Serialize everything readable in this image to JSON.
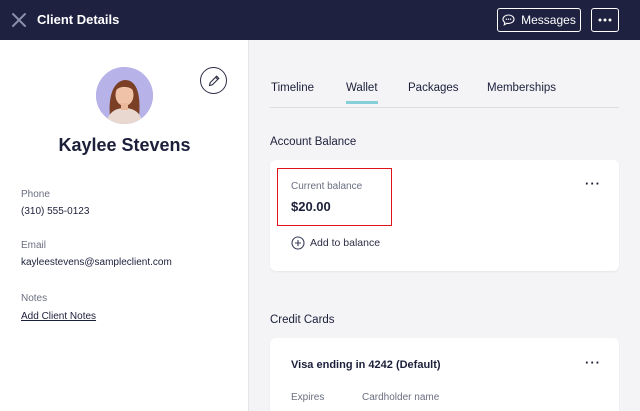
{
  "header": {
    "title": "Client Details",
    "messages_label": "Messages"
  },
  "client": {
    "name": "Kaylee Stevens",
    "phone_label": "Phone",
    "phone": "(310) 555-0123",
    "email_label": "Email",
    "email": "kayleestevens@sampleclient.com",
    "notes_label": "Notes",
    "notes_link": "Add Client Notes"
  },
  "tabs": [
    {
      "label": "Timeline",
      "active": false
    },
    {
      "label": "Wallet",
      "active": true
    },
    {
      "label": "Packages",
      "active": false
    },
    {
      "label": "Memberships",
      "active": false
    }
  ],
  "wallet": {
    "account_balance_title": "Account Balance",
    "current_balance_label": "Current balance",
    "current_balance_value": "$20.00",
    "add_to_balance_label": "Add to balance",
    "credit_cards_title": "Credit Cards",
    "card_title": "Visa ending in 4242 (Default)",
    "expires_label": "Expires",
    "cardholder_label": "Cardholder name"
  },
  "colors": {
    "topbar": "#1e2140",
    "accent_tab": "#86cfd8",
    "highlight": "#e0121a"
  }
}
